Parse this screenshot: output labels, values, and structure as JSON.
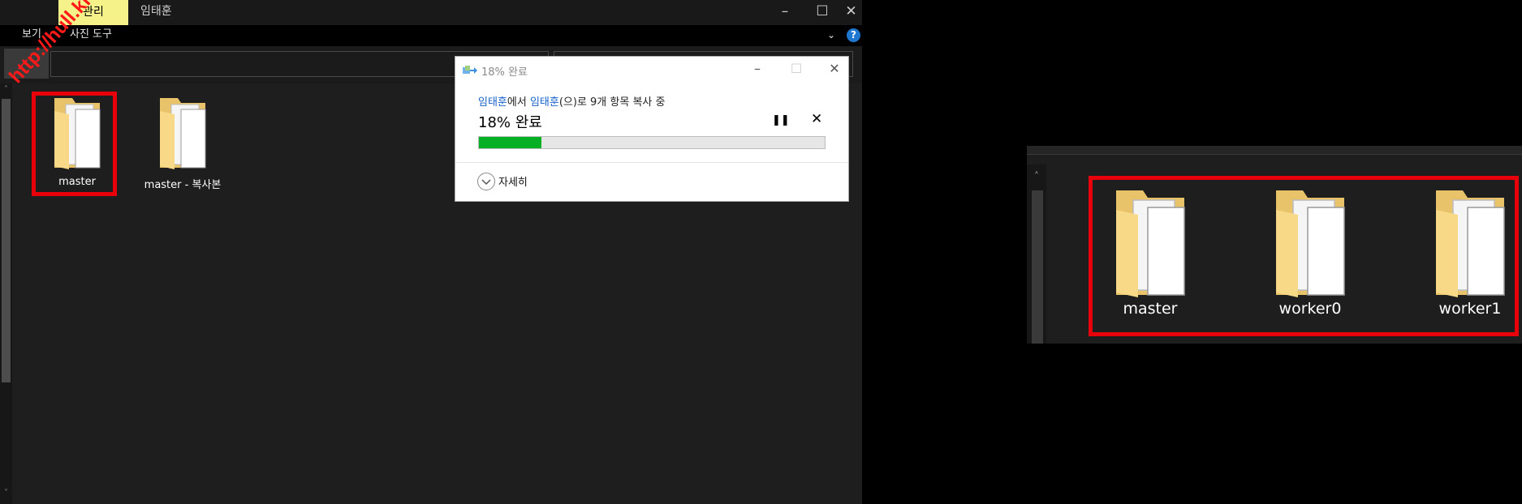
{
  "explorer": {
    "tab_manage": "관리",
    "title": "임태훈",
    "window_controls": {
      "minimize": "–",
      "maximize": "☐",
      "close": "✕"
    },
    "ribbon": {
      "view": "보기",
      "picture_tools": "사진 도구",
      "help": "?"
    },
    "watermark": "http://hull.kr",
    "files": [
      {
        "name": "master",
        "icon": "folder-with-documents-icon",
        "selected": true
      },
      {
        "name": "master - 복사본",
        "icon": "folder-with-documents-icon",
        "selected": false
      }
    ]
  },
  "copy_dialog": {
    "title": "18% 완료",
    "source": "임태훈",
    "from_suffix": "에서 ",
    "destination": "임태훈",
    "to_suffix": "(으)로 9개 항목 복사 중",
    "status": "18% 완료",
    "progress_percent": 18,
    "details": "자세히",
    "pause_icon": "pause-icon",
    "cancel_icon": "cancel-icon"
  },
  "zoomed_view": {
    "folders": [
      "master",
      "worker0",
      "worker1"
    ]
  },
  "colors": {
    "explorer_bg": "#1e1e1e",
    "tab_highlight": "#f4f289",
    "selection_box": "#e8000a",
    "progress_fill": "#06b025",
    "link": "#1a63c9"
  }
}
